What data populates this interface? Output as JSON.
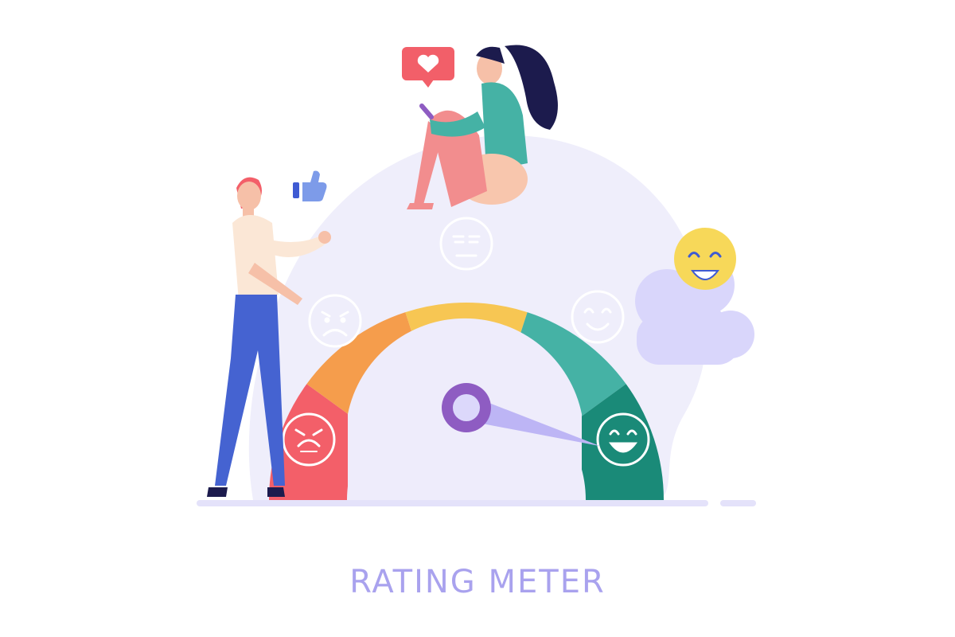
{
  "caption": "RATING METER",
  "meter": {
    "segments": [
      {
        "name": "bad",
        "color": "#f35f69"
      },
      {
        "name": "sad",
        "color": "#f59d4c"
      },
      {
        "name": "neutral",
        "color": "#f7c653"
      },
      {
        "name": "happy",
        "color": "#45b2a5"
      },
      {
        "name": "great",
        "color": "#1a8a78"
      }
    ],
    "level": 0.93,
    "needle_color": "#bdb5f5",
    "hub_color": "#8e5cc2"
  },
  "colors": {
    "backdrop": "#eeecfb",
    "ground": "#e5e3fa",
    "emoji_yellow": "#f7d859",
    "cloud": "#d9d6fb",
    "heart_bubble": "#f25f69",
    "thumb": "#7d9be9"
  },
  "icons": [
    "heart-icon",
    "thumbs-up-icon",
    "smiley-face-icon",
    "cloud-icon"
  ]
}
